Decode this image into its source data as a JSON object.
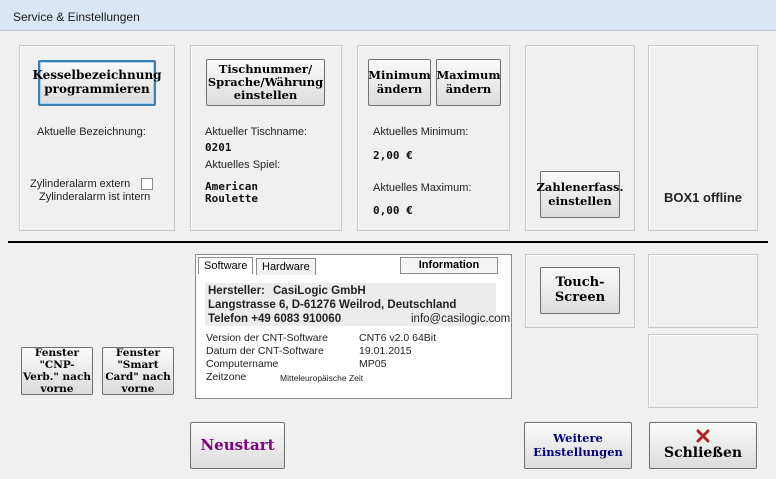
{
  "window": {
    "title": "Service & Einstellungen"
  },
  "kessel": {
    "button_label": "Kesselbezeichnung programmieren",
    "current_label": "Aktuelle Bezeichnung:",
    "alarm_label": "Zylinderalarm extern",
    "alarm_status": "Zylinderalarm ist intern"
  },
  "table": {
    "button_label": "Tischnummer/ Sprache/Währung einstellen",
    "tablename_label": "Aktueller Tischname:",
    "tablename_value": "0201",
    "game_label": "Aktuelles Spiel:",
    "game_value": "American\nRoulette"
  },
  "limits": {
    "min_button": "Minimum ändern",
    "max_button": "Maximum ändern",
    "min_label": "Aktuelles Minimum:",
    "min_value": "2,00 €",
    "max_label": "Aktuelles Maximum:",
    "max_value": "0,00 €"
  },
  "numbers": {
    "button_label": "Zahlenerfass. einstellen"
  },
  "box": {
    "status": "BOX1 offline"
  },
  "windows": {
    "cnp_button": "Fenster \"CNP-Verb.\" nach vorne",
    "smartcard_button": "Fenster \"Smart Card\" nach vorne"
  },
  "info": {
    "tabs": [
      "Software",
      "Hardware"
    ],
    "header": "Information",
    "manufacturer_label": "Hersteller:",
    "manufacturer": "CasiLogic GmbH",
    "address": "Langstrasse 6, D-61276 Weilrod, Deutschland",
    "phone": "Telefon +49 6083 910060",
    "email": "info@casilogic.com",
    "rows": [
      {
        "label": "Version der CNT-Software",
        "value": "CNT6 v2.0 64Bit"
      },
      {
        "label": "Datum der CNT-Software",
        "value": "19.01.2015"
      },
      {
        "label": "Computername",
        "value": "MP05"
      },
      {
        "label": "Zeitzone",
        "value": "Mitteleuropäische Zeit"
      }
    ]
  },
  "touch": {
    "button_label": "Touch-Screen"
  },
  "bottom": {
    "restart_label": "Neustart",
    "more_settings_label": "Weitere Einstellungen",
    "close_label": "Schließen",
    "close_icon": "x-icon"
  },
  "colors": {
    "restart": "#800080",
    "more_settings": "#000080",
    "close_icon": "#b22222"
  }
}
